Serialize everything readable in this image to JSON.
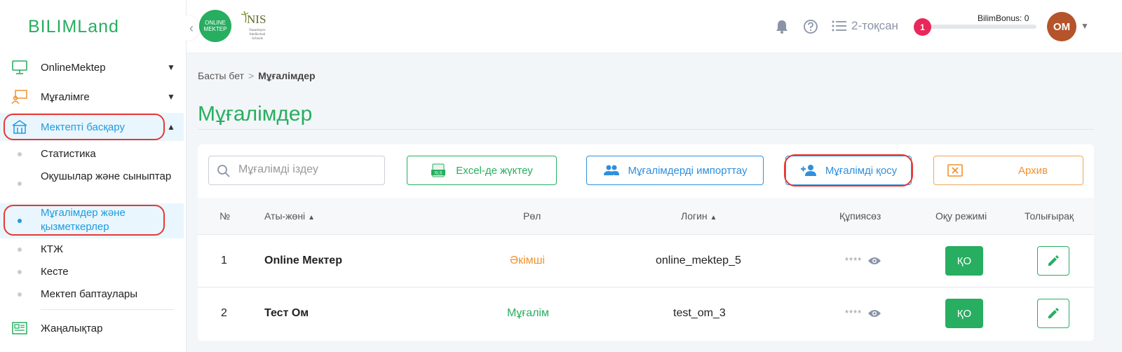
{
  "app": {
    "logo": "BILIMLand"
  },
  "sidebar": {
    "items": [
      {
        "label": "OnlineMektep"
      },
      {
        "label": "Мұғалімге"
      },
      {
        "label": "Мектепті басқару"
      },
      {
        "label": "Жаңалықтар"
      }
    ],
    "subitems": [
      {
        "label": "Статистика"
      },
      {
        "label": "Оқушылар және сыныптар"
      },
      {
        "label": "Мұғалімдер және қызметкерлер"
      },
      {
        "label": "КТЖ"
      },
      {
        "label": "Кесте"
      },
      {
        "label": "Мектеп баптаулары"
      }
    ]
  },
  "header": {
    "partner_logo_text": [
      "ONLINE",
      "MEKTEP"
    ],
    "nis_title": "NIS",
    "nis_sub": [
      "Nazarbayev",
      "Intellectual",
      "Schools"
    ],
    "quarter": "2-тоқсан",
    "bonus_label": "BilimBonus: 0",
    "bonus_level": 1,
    "avatar_initials": "ОМ"
  },
  "breadcrumb": {
    "home": "Басты бет",
    "current": "Мұғалімдер"
  },
  "page_title": "Мұғалімдер",
  "toolbar": {
    "search_placeholder": "Мұғалімді іздеу",
    "excel_label": "Excel-де жүктеу",
    "excel_icon_text": "XLS",
    "import_label": "Мұғалімдерді импорттау",
    "add_label": "Мұғалімді қосу",
    "archive_label": "Архив"
  },
  "table": {
    "columns": [
      "№",
      "Аты-жөні",
      "Рөл",
      "Логин",
      "Құпиясөз",
      "Оқу режимі",
      "Толығырақ"
    ],
    "rows": [
      {
        "num": "1",
        "name": "Online Mектep",
        "role": "Әкімші",
        "login": "online_mektep_5",
        "password": "****",
        "mode": "ҚО"
      },
      {
        "num": "2",
        "name": "Тест Ом",
        "role": "Мұғалім",
        "login": "test_om_3",
        "password": "****",
        "mode": "ҚО"
      }
    ]
  },
  "colors": {
    "brand_green": "#27ae60",
    "accent_blue": "#2f8fdc",
    "archive_orange": "#f0922f",
    "highlight_red": "#e53935",
    "badge_pink": "#e9275a"
  }
}
